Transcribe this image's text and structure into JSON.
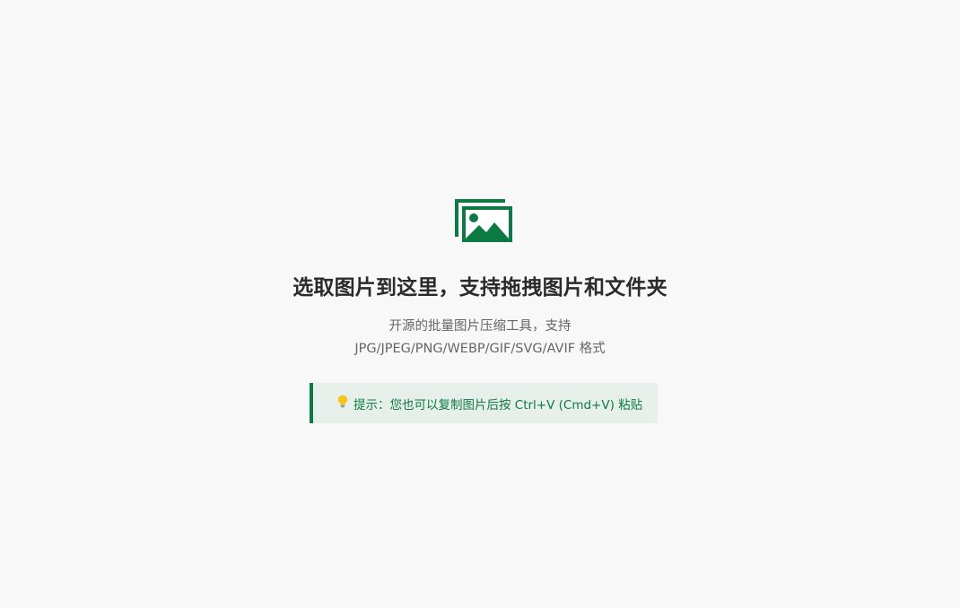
{
  "dropzone": {
    "icon": "images-icon",
    "title": "选取图片到这里，支持拖拽图片和文件夹",
    "desc_line1": "开源的批量图片压缩工具，支持",
    "desc_line2": "JPG/JPEG/PNG/WEBP/GIF/SVG/AVIF 格式"
  },
  "hint": {
    "icon": "lightbulb-icon",
    "text": "提示：您也可以复制图片后按 Ctrl+V (Cmd+V) 粘贴"
  },
  "colors": {
    "brand": "#0e7a43",
    "background": "#f8f8f8",
    "hint_background": "#e6efe9"
  }
}
